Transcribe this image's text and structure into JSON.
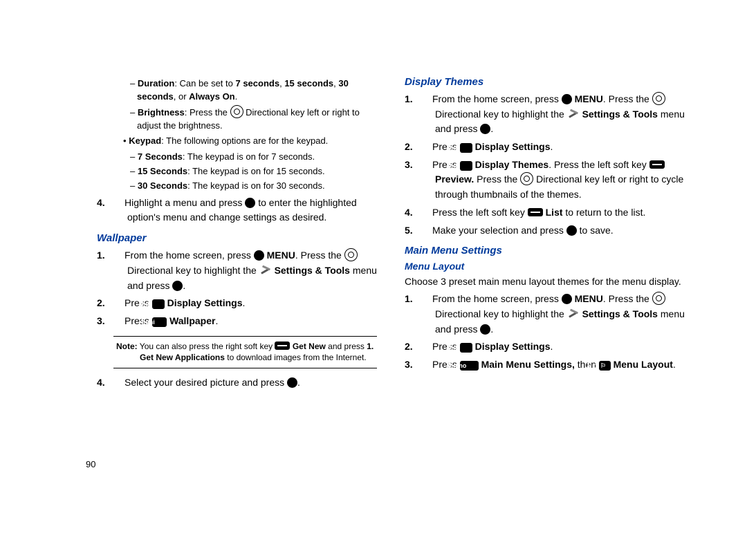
{
  "pageNumber": "90",
  "left": {
    "durationLine": {
      "dash": "–",
      "label": "Duration",
      "text1": ": Can be set to ",
      "opt1": "7 seconds",
      "sep1": ", ",
      "opt2": "15 seconds",
      "sep2": ", ",
      "opt3": "30 seconds",
      "sep3": ", or ",
      "opt4": "Always On",
      "end": "."
    },
    "brightnessLine": {
      "dash": "–",
      "label": "Brightness",
      "text1": ": Press the ",
      "text2": " Directional key left or right to adjust the brightness."
    },
    "keypadLine": {
      "bullet": "•",
      "label": "Keypad",
      "text": ": The following options are for the keypad."
    },
    "k7": {
      "dash": "–",
      "label": "7 Seconds",
      "text": ": The keypad is on for 7 seconds."
    },
    "k15": {
      "dash": "–",
      "label": "15 Seconds",
      "text": ": The keypad is on for 15 seconds."
    },
    "k30": {
      "dash": "–",
      "label": "30 Seconds",
      "text": ": The keypad is on for 30 seconds."
    },
    "step4": {
      "num": "4.",
      "t1": "Highlight a menu and press ",
      "t2": " to enter the highlighted option's menu and change settings as desired."
    },
    "wallpaperTitle": "Wallpaper",
    "w1": {
      "num": "1.",
      "t1": "From the home screen, press ",
      "menu": "MENU",
      "t2": ". Press the ",
      "t3": " Directional key to highlight the ",
      "st": "Settings & Tools",
      "t4": " menu and press ",
      "t5": "."
    },
    "w2": {
      "num": "2.",
      "t1": "Press ",
      "key": "5 jkl",
      "label": "Display Settings",
      "end": "."
    },
    "w3": {
      "num": "3.",
      "t1": "Press ",
      "key": "4 ghi",
      "label": "Wallpaper",
      "end": "."
    },
    "note": {
      "label": "Note:",
      "t1": " You can also press the right soft key ",
      "getnew": "Get New",
      "t2": " and press ",
      "one": "1. Get New Applications",
      "t3": " to download images from the Internet."
    },
    "w4": {
      "num": "4.",
      "t1": "Select your desired picture and press ",
      "t2": "."
    }
  },
  "right": {
    "displayThemesTitle": "Display Themes",
    "d1": {
      "num": "1.",
      "t1": "From the home screen, press ",
      "menu": "MENU",
      "t2": ". Press the ",
      "t3": " Directional key to highlight the ",
      "st": "Settings & Tools",
      "t4": " menu and press ",
      "t5": "."
    },
    "d2": {
      "num": "2.",
      "t1": "Press ",
      "key": "5 jkl",
      "label": "Display Settings",
      "end": "."
    },
    "d3": {
      "num": "3.",
      "t1": "Press ",
      "key": "5 jkl",
      "label": "Display Themes",
      "t2": ". Press the left soft key ",
      "preview": "Preview.",
      "t3": " Press the ",
      "t4": " Directional key left or right to cycle through thumbnails of the themes."
    },
    "d4": {
      "num": "4.",
      "t1": "Press the left soft key ",
      "list": "List",
      "t2": " to return to the list."
    },
    "d5": {
      "num": "5.",
      "t1": "Make your selection and press ",
      "t2": " to save."
    },
    "mainMenuTitle": "Main Menu Settings",
    "menuLayoutTitle": "Menu Layout",
    "mlIntro": "Choose 3 preset main menu layout themes for the menu display.",
    "m1": {
      "num": "1.",
      "t1": "From the home screen, press ",
      "menu": "MENU",
      "t2": ". Press the ",
      "t3": " Directional key to highlight the ",
      "st": "Settings & Tools",
      "t4": " menu and press ",
      "t5": "."
    },
    "m2": {
      "num": "2.",
      "t1": "Press ",
      "key": "5 jkl",
      "label": "Display Settings",
      "end": "."
    },
    "m3": {
      "num": "3.",
      "t1": "Press ",
      "key6": "6 mno",
      "mms": "Main Menu Settings,",
      "then": " then ",
      "key1": "1 @ ⚐",
      "ml": "Menu Layout",
      "end": "."
    }
  }
}
